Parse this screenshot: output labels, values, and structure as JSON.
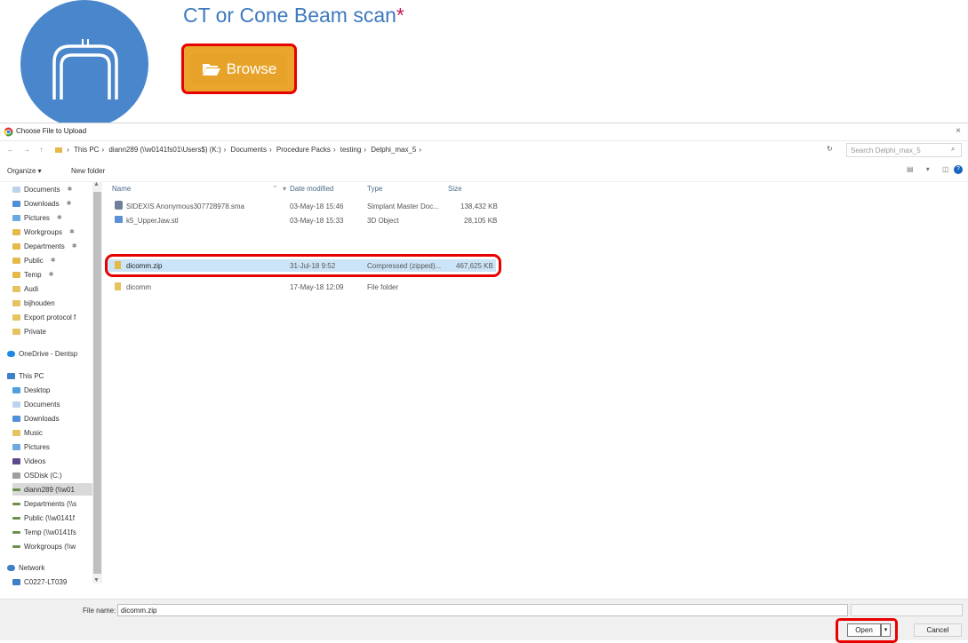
{
  "header": {
    "title": "CT or Cone Beam scan",
    "required_mark": "*",
    "browse_label": "Browse",
    "icon_color": "#4a86cc",
    "browse_color": "#e7a22a"
  },
  "dialog": {
    "title": "Choose File to Upload",
    "close_glyph": "×",
    "nav_glyphs": "← → ↑",
    "breadcrumb": [
      "This PC",
      "diann289 (\\\\w0141fs01\\Users$) (K:)",
      "Documents",
      "Procedure Packs",
      "testing",
      "Delphi_max_5"
    ],
    "breadcrumb_sep": "›",
    "refresh_glyph": "↻",
    "search_placeholder": "Search Delphi_max_5",
    "search_glyph": "⌕",
    "toolbar": {
      "organize": "Organize ▾",
      "new_folder": "New folder",
      "view_glyphs": "▤ ▾ ◫",
      "help_glyph": "?"
    },
    "nav": {
      "quick": [
        {
          "label": "Documents",
          "pinned": true
        },
        {
          "label": "Downloads",
          "pinned": true
        },
        {
          "label": "Pictures",
          "pinned": true
        },
        {
          "label": "Workgroups",
          "pinned": true
        },
        {
          "label": "Departments",
          "pinned": true
        },
        {
          "label": "Public",
          "pinned": true
        },
        {
          "label": "Temp",
          "pinned": true
        },
        {
          "label": "Audi",
          "pinned": false
        },
        {
          "label": "bijhouden",
          "pinned": false
        },
        {
          "label": "Export protocol f",
          "pinned": false
        },
        {
          "label": "Private",
          "pinned": false
        }
      ],
      "pin_glyph": "✱",
      "onedrive": "OneDrive - Dentsp",
      "this_pc": "This PC",
      "pc_items": [
        "Desktop",
        "Documents",
        "Downloads",
        "Music",
        "Pictures",
        "Videos",
        "OSDisk (C:)",
        "diann289 (\\\\w01",
        "Departments (\\\\s",
        "Public (\\\\w0141f",
        "Temp (\\\\w0141fs",
        "Workgroups (\\\\w"
      ],
      "network": "Network",
      "network_items": [
        "C0227-LT039"
      ]
    },
    "columns": {
      "name": "Name",
      "date": "Date modified",
      "type": "Type",
      "size": "Size"
    },
    "files": [
      {
        "name": "SIDEXIS Anonymous307728978.sma",
        "date": "03-May-18 15:46",
        "type": "Simplant Master Doc...",
        "size": "138,432 KB",
        "icon": "sma-file-icon"
      },
      {
        "name": "k5_UpperJaw.stl",
        "date": "03-May-18 15:33",
        "type": "3D Object",
        "size": "28,105 KB",
        "icon": "stl-file-icon"
      },
      {
        "name": "dicomm.zip",
        "date": "31-Jul-18 9:52",
        "type": "Compressed (zipped)...",
        "size": "467,625 KB",
        "icon": "zip-folder-icon",
        "selected": true
      },
      {
        "name": "dicomm",
        "date": "17-May-18 12:09",
        "type": "File folder",
        "size": "",
        "icon": "folder-icon"
      }
    ],
    "footer": {
      "file_name_label": "File name:",
      "file_name_value": "dicomm.zip",
      "open": "Open",
      "open_drop": "▾",
      "cancel": "Cancel"
    }
  }
}
